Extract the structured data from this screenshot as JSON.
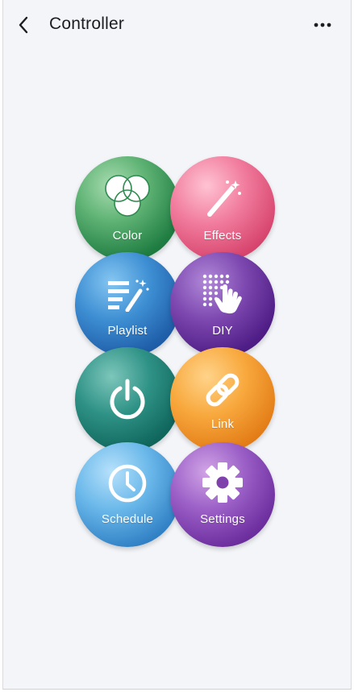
{
  "header": {
    "title": "Controller",
    "back_icon": "chevron-left-icon",
    "more_icon": "more-horizontal-icon"
  },
  "buttons": [
    {
      "id": "color",
      "label": "Color",
      "icon": "color-circles-icon",
      "color": "#2e8b4f"
    },
    {
      "id": "effects",
      "label": "Effects",
      "icon": "magic-wand-icon",
      "color": "#e45b81"
    },
    {
      "id": "playlist",
      "label": "Playlist",
      "icon": "playlist-wand-icon",
      "color": "#2a6fbf"
    },
    {
      "id": "diy",
      "label": "DIY",
      "icon": "diy-hand-grid-icon",
      "color": "#5e2a93"
    },
    {
      "id": "power",
      "label": "",
      "icon": "power-icon",
      "color": "#137a6d"
    },
    {
      "id": "link",
      "label": "Link",
      "icon": "link-icon",
      "color": "#ef942a"
    },
    {
      "id": "schedule",
      "label": "Schedule",
      "icon": "clock-icon",
      "color": "#4796d5"
    },
    {
      "id": "settings",
      "label": "Settings",
      "icon": "gear-icon",
      "color": "#7f42ad"
    }
  ]
}
